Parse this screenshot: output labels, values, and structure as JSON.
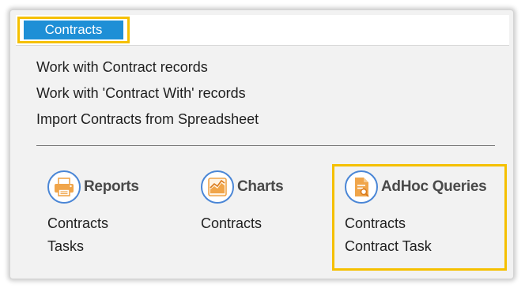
{
  "menubar": {
    "active_tab": "Contracts"
  },
  "menu": {
    "items": [
      "Work with Contract records",
      "Work with 'Contract With' records",
      "Import Contracts from Spreadsheet"
    ]
  },
  "sections": {
    "reports": {
      "title": "Reports",
      "icon": "printer-icon",
      "links": [
        "Contracts",
        "Tasks"
      ]
    },
    "charts": {
      "title": "Charts",
      "icon": "chart-icon",
      "links": [
        "Contracts"
      ]
    },
    "adhoc": {
      "title": "AdHoc Queries",
      "icon": "document-search-icon",
      "links": [
        "Contracts",
        "Contract Task"
      ]
    }
  },
  "colors": {
    "tab_bg": "#1e8fd6",
    "highlight": "#f5c000",
    "icon_ring": "#4a86d6",
    "icon_orange": "#f0a54a"
  }
}
